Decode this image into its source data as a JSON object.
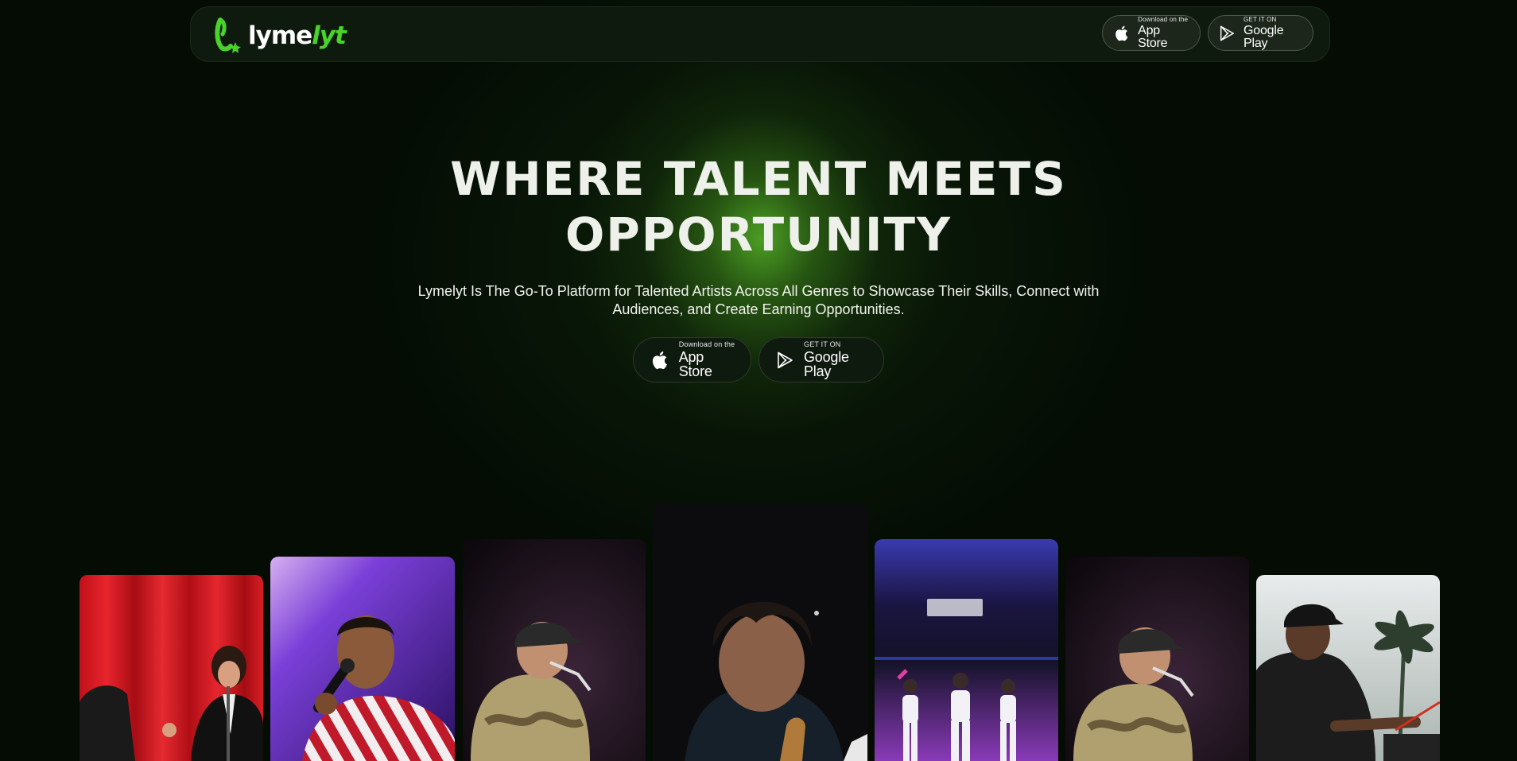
{
  "brand": {
    "name_part1": "lyme",
    "name_part2": "lyt",
    "accent_color": "#49d32a"
  },
  "nav": {
    "app_store": {
      "small": "Download on the",
      "big": "App Store",
      "icon": "apple-icon"
    },
    "google_play": {
      "small": "GET IT ON",
      "big": "Google Play",
      "icon": "google-play-icon"
    }
  },
  "hero": {
    "title_line1": "WHERE TALENT MEETS",
    "title_line2": "OPPORTUNITY",
    "subtitle_line1": "Lymelyt Is The Go-To Platform for Talented Artists Across All Genres to Showcase Their Skills, Connect with",
    "subtitle_line2": "Audiences, and Create Earning Opportunities.",
    "app_store": {
      "small": "Download on the",
      "big": "App Store",
      "icon": "apple-icon"
    },
    "google_play": {
      "small": "GET IT ON",
      "big": "Google Play",
      "icon": "google-play-icon"
    }
  },
  "gallery": {
    "cards": [
      {
        "name": "singer-red-curtain"
      },
      {
        "name": "singer-striped-shirt"
      },
      {
        "name": "rapper-cap-1"
      },
      {
        "name": "guitarist-closeup"
      },
      {
        "name": "dancers-trio"
      },
      {
        "name": "rapper-cap-2"
      },
      {
        "name": "musician-keyboard-palms"
      }
    ]
  }
}
